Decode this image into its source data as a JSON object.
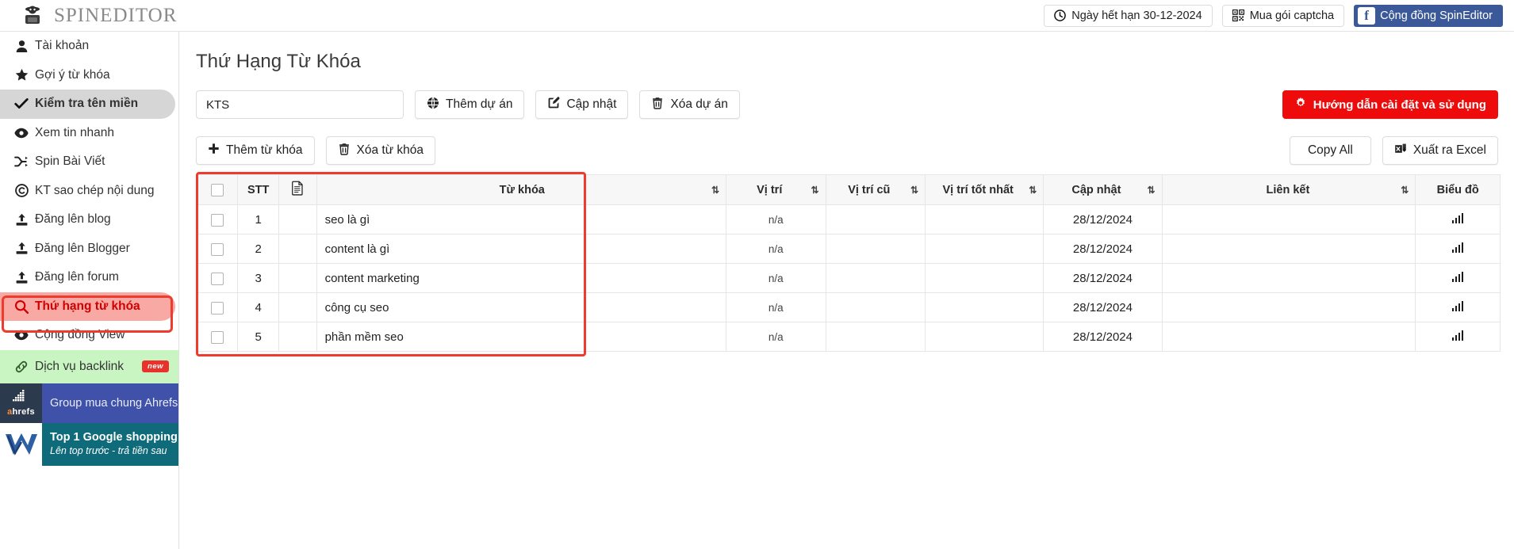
{
  "header": {
    "brand": "SPINEDITOR",
    "logo_icon": "spy-logo-icon",
    "expiry_button": {
      "label": "Ngày hết hạn 30-12-2024",
      "icon": "clock-icon"
    },
    "captcha_button": {
      "label": "Mua gói captcha",
      "icon": "qr-code-icon"
    },
    "facebook_button": {
      "label": "Cộng đồng SpinEditor",
      "icon": "facebook-icon",
      "badge": "f",
      "color": "#3b5998"
    }
  },
  "sidebar": {
    "items": [
      {
        "label": "Tài khoản",
        "icon": "user-icon",
        "state": "normal"
      },
      {
        "label": "Gợi ý từ khóa",
        "icon": "star-icon",
        "state": "normal"
      },
      {
        "label": "Kiểm tra tên miền",
        "icon": "check-icon",
        "state": "active"
      },
      {
        "label": "Xem tin nhanh",
        "icon": "eye-icon",
        "state": "normal"
      },
      {
        "label": "Spin Bài Viết",
        "icon": "shuffle-icon",
        "state": "normal"
      },
      {
        "label": "KT sao chép nội dung",
        "icon": "copyright-icon",
        "state": "normal"
      },
      {
        "label": "Đăng lên blog",
        "icon": "upload-icon",
        "state": "normal"
      },
      {
        "label": "Đăng lên Blogger",
        "icon": "upload-icon",
        "state": "normal"
      },
      {
        "label": "Đăng lên forum",
        "icon": "upload-icon",
        "state": "normal"
      },
      {
        "label": "Thứ hạng từ khóa",
        "icon": "search-icon",
        "state": "highlight"
      },
      {
        "label": "Cộng đồng View",
        "icon": "eye-icon",
        "state": "normal"
      }
    ],
    "backlink": {
      "label": "Dịch vụ backlink",
      "icon": "link-icon",
      "badge": "new",
      "badge_color": "#e8322b",
      "bg": "#c9f5c2"
    },
    "promos": [
      {
        "title": "Group mua chung Ahrefs",
        "subtitle": "",
        "brand": "ahrefs",
        "bg": "#3f51a8"
      },
      {
        "title": "Top 1 Google shopping",
        "subtitle": "Lên top trước - trả tiền sau",
        "brand": "W",
        "bg": "#0f6b7a"
      }
    ],
    "highlight_color": "#ef3b2d"
  },
  "main": {
    "page_title": "Thứ Hạng Từ Khóa",
    "project_input": {
      "value": "KTS",
      "placeholder": ""
    },
    "buttons": {
      "add_project": {
        "label": "Thêm dự án",
        "icon": "globe-icon"
      },
      "update": {
        "label": "Cập nhật",
        "icon": "edit-icon"
      },
      "delete_project": {
        "label": "Xóa dự án",
        "icon": "trash-icon"
      },
      "add_keyword": {
        "label": "Thêm từ khóa",
        "icon": "plus-icon"
      },
      "delete_keyword": {
        "label": "Xóa từ khóa",
        "icon": "trash-icon"
      },
      "guide": {
        "label": "Hướng dẫn cài đặt và sử dụng",
        "icon": "gear-icon",
        "color": "#ee0b0b"
      },
      "copy_all": {
        "label": "Copy All",
        "icon": ""
      },
      "export_excel": {
        "label": "Xuất ra Excel",
        "icon": "excel-icon"
      }
    }
  },
  "table": {
    "columns": [
      {
        "key": "check",
        "label": "",
        "icon": "checkbox-icon",
        "sortable": false
      },
      {
        "key": "stt",
        "label": "STT",
        "sortable": false
      },
      {
        "key": "doc",
        "label": "",
        "icon": "document-icon",
        "sortable": false
      },
      {
        "key": "keyword",
        "label": "Từ khóa",
        "sortable": true
      },
      {
        "key": "position",
        "label": "Vị trí",
        "sortable": true
      },
      {
        "key": "old_position",
        "label": "Vị trí cũ",
        "sortable": true
      },
      {
        "key": "best_position",
        "label": "Vị trí tốt nhất",
        "sortable": true
      },
      {
        "key": "updated",
        "label": "Cập nhật",
        "sortable": true
      },
      {
        "key": "link",
        "label": "Liên kết",
        "sortable": true
      },
      {
        "key": "chart",
        "label": "Biểu đồ",
        "sortable": false
      }
    ],
    "rows": [
      {
        "stt": "1",
        "keyword": "seo là gì",
        "position": "n/a",
        "old_position": "",
        "best_position": "",
        "updated": "28/12/2024",
        "link": "",
        "chart": "bar-chart-icon"
      },
      {
        "stt": "2",
        "keyword": "content là gì",
        "position": "n/a",
        "old_position": "",
        "best_position": "",
        "updated": "28/12/2024",
        "link": "",
        "chart": "bar-chart-icon"
      },
      {
        "stt": "3",
        "keyword": "content marketing",
        "position": "n/a",
        "old_position": "",
        "best_position": "",
        "updated": "28/12/2024",
        "link": "",
        "chart": "bar-chart-icon"
      },
      {
        "stt": "4",
        "keyword": "công cụ seo",
        "position": "n/a",
        "old_position": "",
        "best_position": "",
        "updated": "28/12/2024",
        "link": "",
        "chart": "bar-chart-icon"
      },
      {
        "stt": "5",
        "keyword": "phần mềm seo",
        "position": "n/a",
        "old_position": "",
        "best_position": "",
        "updated": "28/12/2024",
        "link": "",
        "chart": "bar-chart-icon"
      }
    ]
  }
}
